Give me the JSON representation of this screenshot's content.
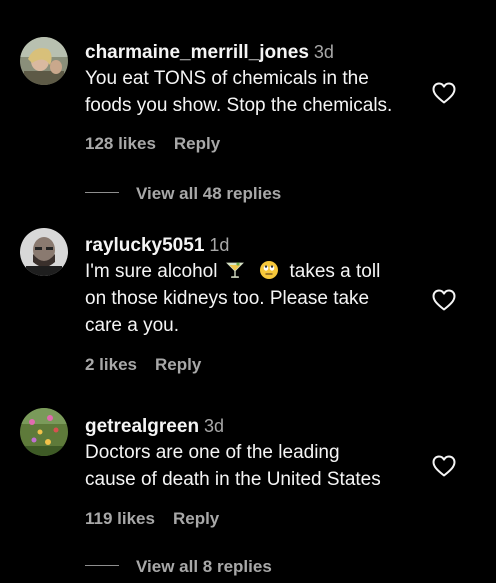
{
  "comments": [
    {
      "username": "charmaine_merrill_jones",
      "time": "3d",
      "text_lines": [
        "You eat TONS of chemicals in the",
        "foods you show. Stop the chemicals."
      ],
      "likes": "128 likes",
      "reply": "Reply",
      "view_replies": "View all 48 replies",
      "avatar_icon": "avatar-photo-woman"
    },
    {
      "username": "raylucky5051",
      "time": "1d",
      "text_line1_a": "I'm sure alcohol",
      "text_line1_b": "takes a toll",
      "text_line2": "on those kidneys too. Please take",
      "text_line3": "care a you.",
      "emojis": [
        "cocktail-glass-icon",
        "face-with-rolling-eyes-icon"
      ],
      "likes": "2 likes",
      "reply": "Reply",
      "avatar_icon": "avatar-photo-man"
    },
    {
      "username": "getrealgreen",
      "time": "3d",
      "text_lines": [
        "Doctors are one of the leading",
        "cause of death in the United States"
      ],
      "likes": "119 likes",
      "reply": "Reply",
      "view_replies": "View all 8 replies",
      "avatar_icon": "avatar-photo-flowers"
    }
  ],
  "like_icon": "heart-outline-icon",
  "colors": {
    "background": "#000000",
    "primary_text": "#f5f5f5",
    "secondary_text": "#a8a8a8"
  }
}
